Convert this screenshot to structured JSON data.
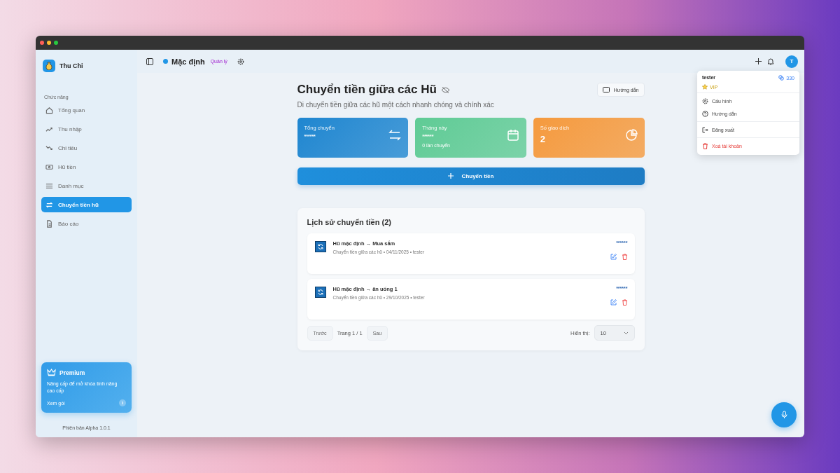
{
  "sidebar": {
    "app_name": "Thu Chi",
    "section_label": "Chức năng",
    "items": [
      {
        "label": "Tổng quan",
        "selected": false
      },
      {
        "label": "Thu nhập",
        "selected": false
      },
      {
        "label": "Chi tiêu",
        "selected": false
      },
      {
        "label": "Hũ tiền",
        "selected": false
      },
      {
        "label": "Danh mục",
        "selected": false
      },
      {
        "label": "Chuyển tiền hũ",
        "selected": true
      },
      {
        "label": "Báo cáo",
        "selected": false
      }
    ],
    "premium": {
      "title": "Premium",
      "text": "Nâng cấp để mở khóa tính năng cao cấp",
      "link": "Xem gói"
    },
    "version": "Phiên bản Alpha 1.0.1"
  },
  "header": {
    "jar_name": "Mặc định",
    "manage_label": "Quản lý",
    "avatar": "T"
  },
  "user_menu": {
    "name": "tester",
    "points": "330",
    "badge": "VIP",
    "groups": [
      {
        "items": [
          {
            "label": "Cấu hình",
            "kind": "normal"
          },
          {
            "label": "Hướng dẫn",
            "kind": "normal"
          }
        ]
      },
      {
        "items": [
          {
            "label": "Đăng xuất",
            "kind": "normal"
          }
        ]
      },
      {
        "items": [
          {
            "label": "Xoá tài khoản",
            "kind": "danger"
          }
        ]
      }
    ]
  },
  "page": {
    "title": "Chuyển tiền giữa các Hũ",
    "subtitle": "Di chuyển tiền giữa các hũ một cách nhanh chóng và chính xác",
    "guide_button": "Hướng dẫn",
    "stats": [
      {
        "label": "Tổng chuyển",
        "value": "******",
        "color": "#1f86d0"
      },
      {
        "label": "Tháng này",
        "value": "******",
        "note": "0 lần chuyển",
        "color": "#5fcb95"
      },
      {
        "label": "Số giao dịch",
        "value": "2",
        "color": "#f59a3e"
      }
    ],
    "transfer_button": "Chuyển tiền"
  },
  "history": {
    "title": "Lịch sử chuyển tiền (2)",
    "items": [
      {
        "title": "Hũ mặc định → Mua sắm",
        "meta": "Chuyển tiền giữa các hũ • 04/11/2025 • tester",
        "amount": "******"
      },
      {
        "title": "Hũ mặc định → ăn uống 1",
        "meta": "Chuyển tiền giữa các hũ • 29/10/2025 • tester",
        "amount": "******"
      }
    ],
    "prev": "Trước",
    "page_info": "Trang 1 / 1",
    "next": "Sau",
    "show_label": "Hiển thị:",
    "page_size": "10"
  }
}
